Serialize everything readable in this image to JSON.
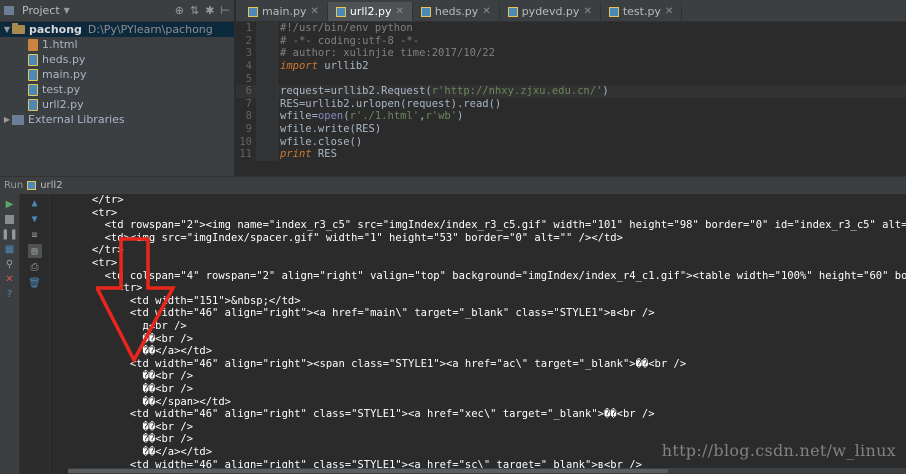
{
  "project_panel": {
    "title": "Project",
    "header_icons": [
      "globe-icon",
      "settings-icon",
      "pin-icon"
    ],
    "root": {
      "name": "pachong",
      "path": "D:\\Py\\PYlearn\\pachong"
    },
    "files": [
      {
        "name": "1.html",
        "type": "html"
      },
      {
        "name": "heds.py",
        "type": "py"
      },
      {
        "name": "main.py",
        "type": "py"
      },
      {
        "name": "test.py",
        "type": "py"
      },
      {
        "name": "urll2.py",
        "type": "py"
      }
    ],
    "external": "External Libraries"
  },
  "editor": {
    "tabs": [
      {
        "label": "main.py",
        "active": false
      },
      {
        "label": "urll2.py",
        "active": true
      },
      {
        "label": "heds.py",
        "active": false
      },
      {
        "label": "pydevd.py",
        "active": false
      },
      {
        "label": "test.py",
        "active": false
      }
    ],
    "line_numbers": [
      "1",
      "2",
      "3",
      "4",
      "5",
      "6",
      "7",
      "8",
      "9",
      "10",
      "11"
    ],
    "current_line": 6,
    "lines": [
      "#!/usr/bin/env python",
      "# -*- coding:utf-8 -*-",
      "# author: xulinjie time:2017/10/22",
      "import urllib2",
      "",
      "request=urllib2.Request(r'http://nhxy.zjxu.edu.cn/')",
      "RES=urllib2.urlopen(request).read()",
      "wfile=open(r'./1.html',r'wb')",
      "wfile.write(RES)",
      "wfile.close()",
      "print RES"
    ]
  },
  "run": {
    "label": "Run",
    "config": "urll2"
  },
  "console": {
    "lines": [
      "      </tr>",
      "      <tr>",
      "        <td rowspan=\"2\"><img name=\"index_r3_c5\" src=\"imgIndex/index_r3_c5.gif\" width=\"101\" height=\"98\" border=\"0\" id=\"index_r3_c5\" alt=\"\"",
      "        <td><img src=\"imgIndex/spacer.gif\" width=\"1\" height=\"53\" border=\"0\" alt=\"\" /></td>",
      "      </tr>",
      "      <tr>",
      "        <td colspan=\"4\" rowspan=\"2\" align=\"right\" valign=\"top\" background=\"imgIndex/index_r4_c1.gif\"><table width=\"100%\" height=\"60\" borde",
      "          <tr>",
      "            <td width=\"151\">&nbsp;</td>",
      "            <td width=\"46\" align=\"right\"><a href=\"main\\\" target=\"_blank\" class=\"STYLE1\">в<br />",
      "              д<br />",
      "              ��<br />",
      "              ��</a></td>",
      "            <td width=\"46\" align=\"right\"><span class=\"STYLE1\"><a href=\"ac\\\" target=\"_blank\">��<br />",
      "              ��<br />",
      "              ��<br />",
      "              ��</span></td>",
      "            <td width=\"46\" align=\"right\" class=\"STYLE1\"><a href=\"xec\\\" target=\"_blank\">��<br />",
      "              ��<br />",
      "              ��<br />",
      "              ��</a></td>",
      "            <td width=\"46\" align=\"right\" class=\"STYLE1\"><a href=\"sc\\\" target=\"_blank\">в<br />"
    ]
  },
  "watermark": "http://blog.csdn.net/w_linux",
  "colors": {
    "panel_bg": "#3c3f41",
    "editor_bg": "#2b2b2b",
    "arrow_red": "#e8261c",
    "keyword": "#cc7832",
    "string": "#6a8759",
    "comment": "#808080"
  }
}
